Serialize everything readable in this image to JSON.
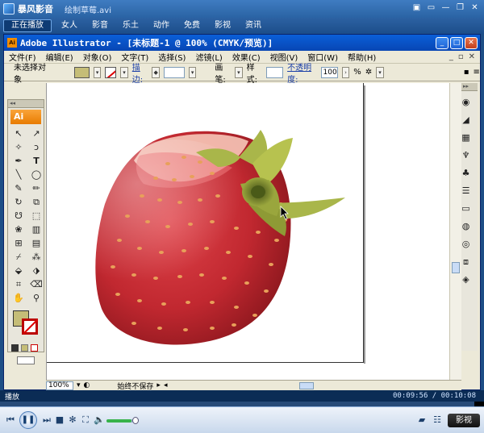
{
  "player": {
    "app_name": "暴风影音",
    "file_name": "绘制草莓.avi",
    "window_controls": {
      "menu": "▣",
      "mini": "▭",
      "minimize": "—",
      "restore": "❐",
      "close": "✕"
    },
    "nav_tabs": [
      "正在播放",
      "女人",
      "影音",
      "乐土",
      "动作",
      "免费",
      "影视",
      "资讯"
    ],
    "state": "播放",
    "time_current": "00:09:56",
    "time_total": "00:10:08",
    "progress": 0.98,
    "volume": 0.85,
    "brand_button": "影视"
  },
  "illustrator": {
    "title": "Adobe Illustrator - [未标题-1 @ 100% (CMYK/预览)]",
    "menu": [
      "文件(F)",
      "编辑(E)",
      "对象(O)",
      "文字(T)",
      "选择(S)",
      "滤镜(L)",
      "效果(C)",
      "视图(V)",
      "窗口(W)",
      "帮助(H)"
    ],
    "control_bar": {
      "selection_state": "未选择对象",
      "stroke_link": "描边:",
      "brush_label": "画笔:",
      "style_label": "样式:",
      "opacity_link": "不透明度:",
      "opacity_value": "100",
      "opacity_unit": "%"
    },
    "tools_logo": "Ai",
    "status": {
      "zoom": "100%",
      "info": "始终不保存"
    },
    "colors": {
      "fill": "#c5bd77",
      "stroke": "none"
    }
  },
  "artwork": {
    "subject": "strawberry",
    "colors": {
      "body_dark": "#9e1a1f",
      "body": "#d0323a",
      "highlight": "#f6c7b8",
      "seed": "#e8a05a",
      "leaf": "#a9b64a",
      "leaf_dark": "#6f7d2a"
    }
  }
}
